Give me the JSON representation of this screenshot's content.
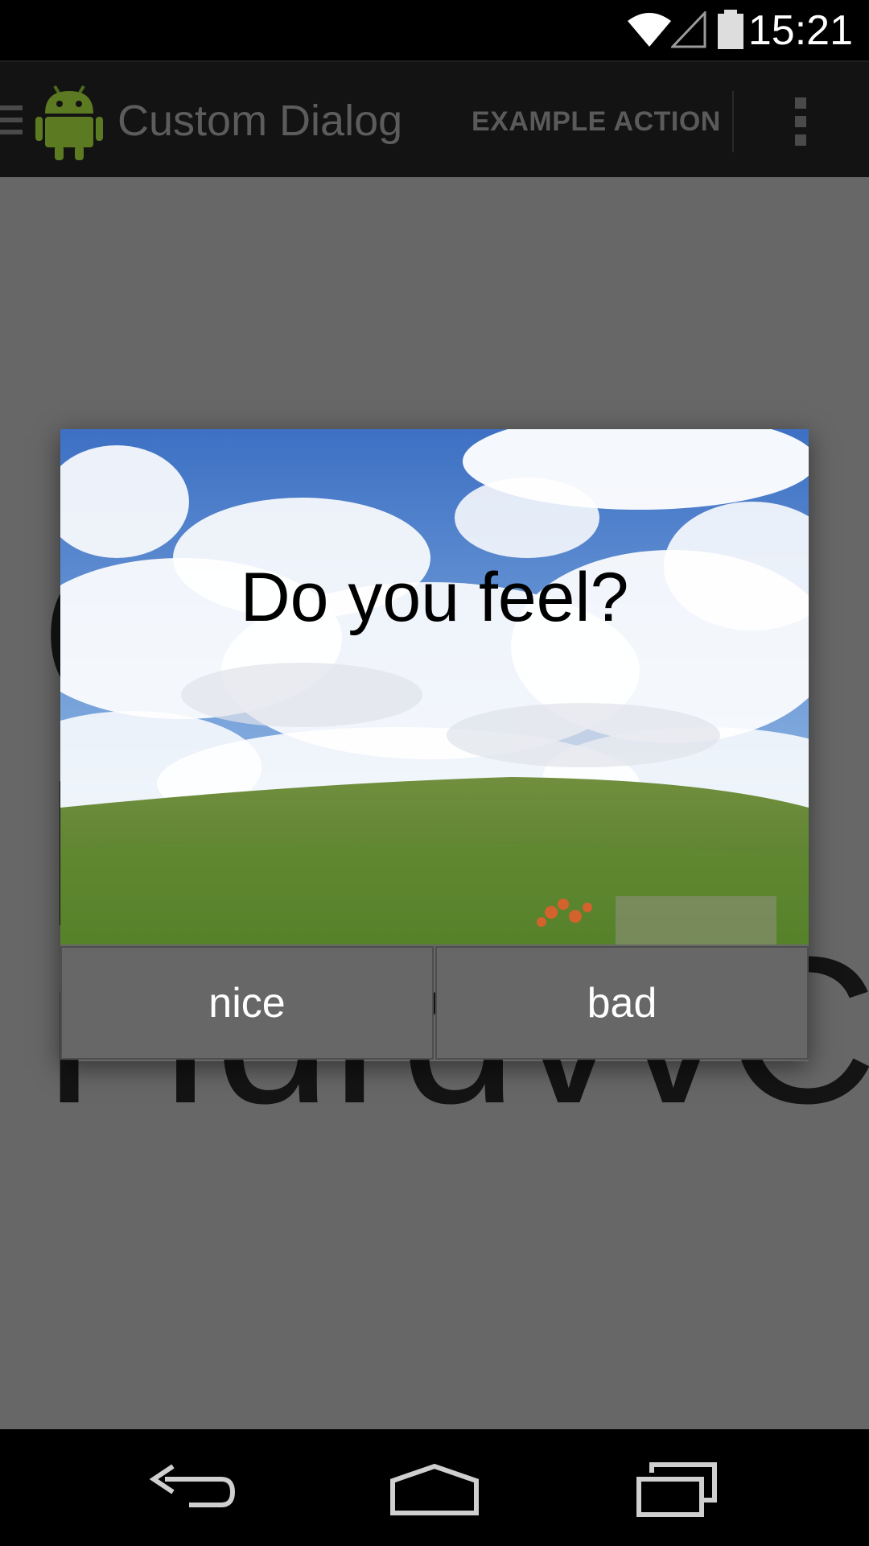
{
  "status_bar": {
    "time": "15:21",
    "icons": [
      "wifi-icon",
      "cell-signal-icon",
      "battery-icon"
    ]
  },
  "action_bar": {
    "title": "Custom Dialog",
    "action_label": "EXAMPLE ACTION",
    "icons": [
      "drawer-menu-icon",
      "android-app-icon",
      "overflow-menu-icon"
    ]
  },
  "background_text": {
    "line1": "C",
    "line2": "I",
    "line3": "ı ıdrdvvCı"
  },
  "dialog": {
    "question": "Do you feel?",
    "buttons": [
      {
        "label": "nice"
      },
      {
        "label": "bad"
      }
    ]
  },
  "nav_bar": {
    "icons": [
      "back-icon",
      "home-icon",
      "recent-apps-icon"
    ]
  },
  "colors": {
    "scrim": "#676767",
    "bars": "#000000",
    "action_bar": "#131313",
    "sky": "#4d7fc9",
    "grass": "#5a7f32"
  }
}
